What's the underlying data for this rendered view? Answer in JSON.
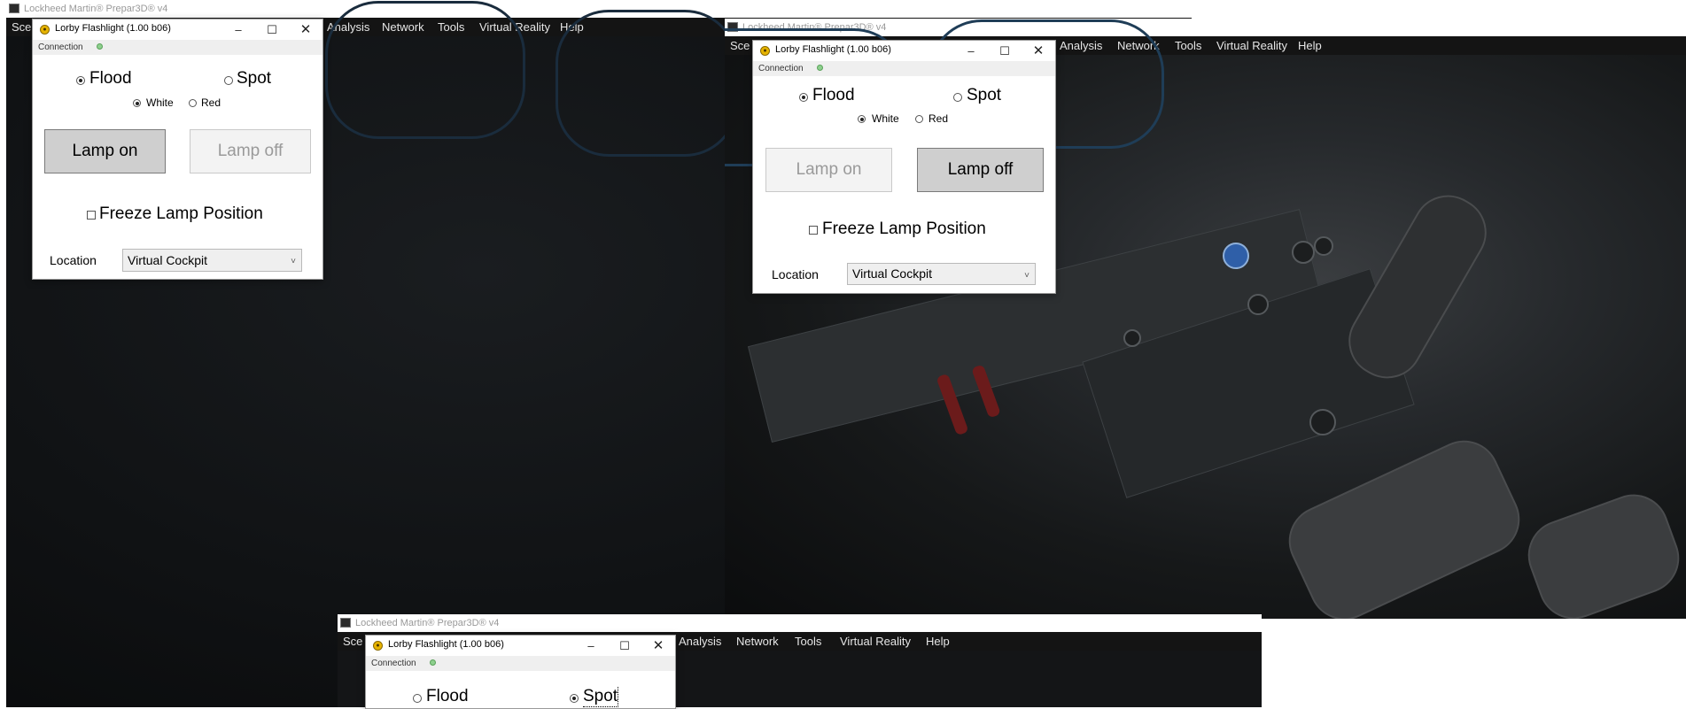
{
  "host_window": {
    "title": "Lockheed Martin® Prepar3D® v4",
    "menu": {
      "scenario_partial": "Sce",
      "analysis": "Analysis",
      "network": "Network",
      "tools": "Tools",
      "virtual_reality": "Virtual Reality",
      "help": "Help"
    }
  },
  "dialogs": [
    {
      "title": "Lorby Flashlight (1.00 b06)",
      "connection_label": "Connection",
      "flood_label": "Flood",
      "spot_label": "Spot",
      "beam_mode": "Flood",
      "white_label": "White",
      "red_label": "Red",
      "color": "White",
      "lamp_on_label": "Lamp on",
      "lamp_off_label": "Lamp off",
      "lamp_state": "off",
      "freeze_label": "Freeze Lamp Position",
      "freeze_checked": false,
      "location_label": "Location",
      "location_value": "Virtual Cockpit"
    },
    {
      "title": "Lorby Flashlight (1.00 b06)",
      "connection_label": "Connection",
      "flood_label": "Flood",
      "spot_label": "Spot",
      "beam_mode": "Flood",
      "white_label": "White",
      "red_label": "Red",
      "color": "White",
      "lamp_on_label": "Lamp on",
      "lamp_off_label": "Lamp off",
      "lamp_state": "on",
      "freeze_label": "Freeze Lamp Position",
      "freeze_checked": false,
      "location_label": "Location",
      "location_value": "Virtual Cockpit"
    },
    {
      "title": "Lorby Flashlight (1.00 b06)",
      "connection_label": "Connection",
      "flood_label": "Flood",
      "spot_label": "Spot",
      "beam_mode": "Spot"
    }
  ],
  "window_controls": {
    "minimize": "–",
    "maximize": "☐",
    "close": "✕"
  },
  "colors": {
    "menubar_bg": "#141414",
    "connection_led": "#8ed08e",
    "app_icon": "#e7b400",
    "ge_badge": "#2f5fa8"
  }
}
